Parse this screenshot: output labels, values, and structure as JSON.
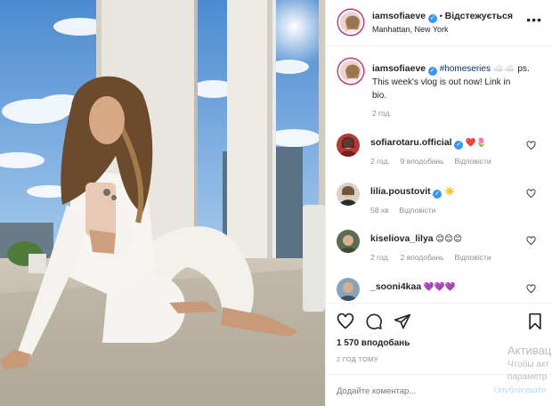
{
  "header": {
    "username": "iamsofiaeve",
    "dot": "•",
    "following": "Відстежується",
    "location": "Manhattan, New York",
    "more_icon": "ellipsis-icon"
  },
  "caption": {
    "username": "iamsofiaeve",
    "hashtag": "#homeseries",
    "emoji": "☁️☁️",
    "text_tail": " ps.",
    "line2": "This week's vlog is out now! Link in",
    "line3": "bio.",
    "time": "2 год."
  },
  "comments": [
    {
      "username": "sofiarotaru.official",
      "emoji": "❤️🌷",
      "time": "2 год.",
      "likes": "9 вподобань",
      "reply": "Відповісти"
    },
    {
      "username": "lilia.poustovit",
      "emoji": "☀️",
      "time": "58 хв",
      "likes": "",
      "reply": "Відповісти"
    },
    {
      "username": "kiseliova_lilya",
      "emoji": "😊😊😊",
      "time": "2 год.",
      "likes": "2 вподобань",
      "reply": "Відповісти"
    },
    {
      "username": "_sooni4kaa",
      "emoji": "💜💜💜",
      "time": "",
      "likes": "",
      "reply": ""
    }
  ],
  "actions": {
    "likes": "1 570 вподобань",
    "posted": "2 ГОД ТОМУ"
  },
  "add_comment": {
    "placeholder": "Додайте коментар...",
    "publish": "Опублікувати"
  },
  "watermark": {
    "line1": "Активац",
    "line2": "Чтобы акт",
    "line3": "параметр"
  },
  "colors": {
    "accent": "#3897f0",
    "text": "#262626",
    "muted": "#8e8e8e",
    "border": "#efefef"
  }
}
